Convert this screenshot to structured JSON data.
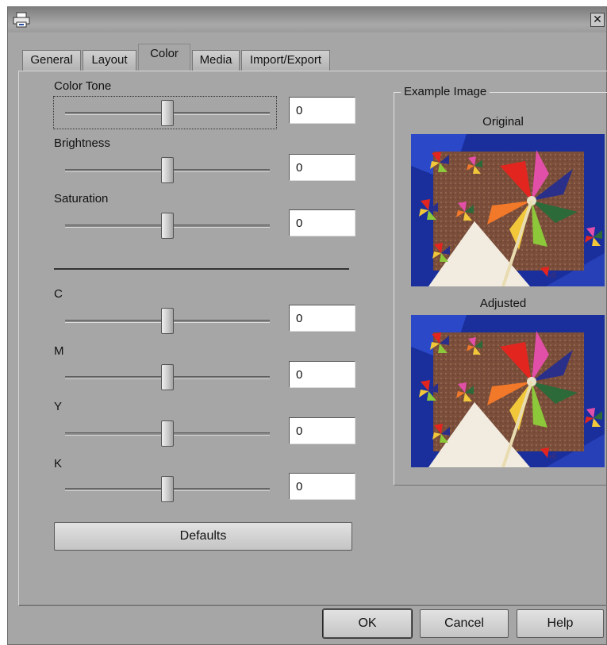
{
  "window": {
    "title": "",
    "close_glyph": "✕",
    "app_icon": "printer-icon"
  },
  "tabs": [
    {
      "label": "General",
      "active": false
    },
    {
      "label": "Layout",
      "active": false
    },
    {
      "label": "Color",
      "active": true
    },
    {
      "label": "Media",
      "active": false
    },
    {
      "label": "Import/Export",
      "active": false
    }
  ],
  "color_controls": [
    {
      "label": "Color Tone",
      "value": "0",
      "slider_fraction": 0.5,
      "focused": true
    },
    {
      "label": "Brightness",
      "value": "0",
      "slider_fraction": 0.5,
      "focused": false
    },
    {
      "label": "Saturation",
      "value": "0",
      "slider_fraction": 0.5,
      "focused": false
    }
  ],
  "cmyk_controls": [
    {
      "label": "C",
      "value": "0",
      "slider_fraction": 0.5
    },
    {
      "label": "M",
      "value": "0",
      "slider_fraction": 0.5
    },
    {
      "label": "Y",
      "value": "0",
      "slider_fraction": 0.5
    },
    {
      "label": "K",
      "value": "0",
      "slider_fraction": 0.5
    }
  ],
  "defaults_label": "Defaults",
  "example": {
    "group_label": "Example Image",
    "original_label": "Original",
    "adjusted_label": "Adjusted"
  },
  "footer": {
    "ok_label": "OK",
    "cancel_label": "Cancel",
    "help_label": "Help"
  }
}
